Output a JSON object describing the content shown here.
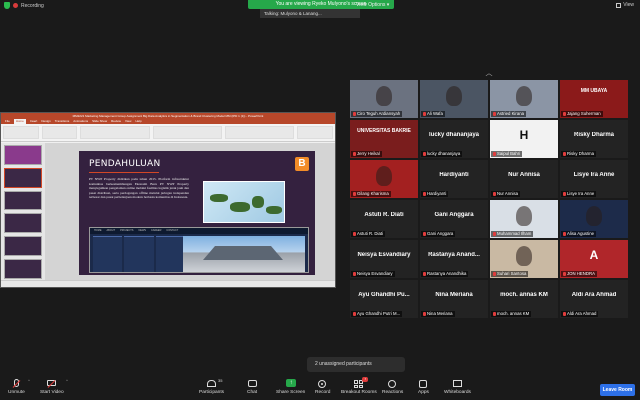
{
  "topbar": {
    "recording_label": "Recording",
    "share_banner": "You are viewing Ryeko Mulyono's screen",
    "view_options": "View Options",
    "view_button": "View",
    "talking_label": "Talking: Mulyono & Lanang..."
  },
  "shared_screen": {
    "ppt_title": "MM2221 Marketing Management Group Assignment Big Data Analytics in Segmentation & Brand Clustering Model MM (IPD 1 (1)) - PowerPoint",
    "ppt_tabs": [
      "File",
      "Home",
      "Insert",
      "Design",
      "Transitions",
      "Animations",
      "Slide Show",
      "Review",
      "View",
      "Help"
    ],
    "active_tab": "Home",
    "slide": {
      "title": "PENDAHULUAN",
      "body": "PT NWP Property didirikan pada tahun 2015. Platform infrastruktur komunitas berkesinambungan Ekonomi Baru PT NWP Property menyuguhkan pengalaman online melalui fasilitas logistik jarak jauh dan pusat distribusi, serta perdagangan offline melalui jaringan independen terbesar dan pusat perbelanjaan modern berbasis komunitas di Indonesia.",
      "logo_letter": "B",
      "banner_nav": [
        "HOME",
        "ABOUT",
        "PROJECTS",
        "NEWS",
        "CAREER",
        "CONTACT"
      ]
    }
  },
  "participants": [
    {
      "display": "",
      "label": "Ciro Teguh Ardiansyah",
      "photo": true,
      "bg": "#6b7280"
    },
    {
      "display": "",
      "label": "Ali Wafa",
      "photo": true,
      "bg": "#4b5563"
    },
    {
      "display": "",
      "label": "Astried Kirana",
      "photo": true,
      "bg": "#8b95a5"
    },
    {
      "display": "",
      "label": "Jajang Suherman",
      "photo": true,
      "bg": "#8b1a1a",
      "text": "MM UBAYA"
    },
    {
      "display": "",
      "label": "Jerry Heikal",
      "photo": true,
      "bg": "#7a1d1d",
      "text": "UNIVERSITAS BAKRIE"
    },
    {
      "display": "lucky dhananjaya",
      "label": "lucky dhananjaya"
    },
    {
      "display": "",
      "label": "Saipul Bahri",
      "photo": true,
      "bg": "#f2f2f2",
      "text": "H"
    },
    {
      "display": "Risky Dharma",
      "label": "Risky Dharma"
    },
    {
      "display": "",
      "label": "Gilang Kharisma",
      "photo": true,
      "bg": "#a32020"
    },
    {
      "display": "Hardiyanti",
      "label": "Hardiyanti"
    },
    {
      "display": "Nur Annisa",
      "label": "Nur Annisa"
    },
    {
      "display": "Lisye Ira Anne",
      "label": "Lisye Ira Anne"
    },
    {
      "display": "Astuti R. Diati",
      "label": "Astuti R. Diati"
    },
    {
      "display": "Gani Anggara",
      "label": "Gani Anggara"
    },
    {
      "display": "",
      "label": "Muhammad Ilham",
      "photo": true,
      "bg": "#d9dfe6"
    },
    {
      "display": "",
      "label": "Alisa Agustine",
      "photo": true,
      "bg": "#1d2b4a"
    },
    {
      "display": "Neisya Esvandiary",
      "label": "Neisya Esvandiary"
    },
    {
      "display": "Rastanya Anand...",
      "label": "Rastanya Anandhika"
    },
    {
      "display": "",
      "label": "Suhari Santosa",
      "photo": true,
      "bg": "#c9b9a3"
    },
    {
      "display": "",
      "label": "JON HENDRA",
      "photo": true,
      "bg": "#b0262a",
      "text": "A"
    },
    {
      "display": "Ayu Ghandhi Pu...",
      "label": "Ayu Ghandhi Putri M..."
    },
    {
      "display": "Nina Meriana",
      "label": "Nina Meriana"
    },
    {
      "display": "moch. annas KM",
      "label": "moch. annas KM"
    },
    {
      "display": "Aldi Ara Ahmad",
      "label": "Aldi Ara Ahmad"
    }
  ],
  "unassigned": "2 unassigned participants",
  "toolbar": {
    "unmute": "Unmute",
    "start_video": "Start Video",
    "participants": "Participants",
    "participants_count": "35",
    "chat": "Chat",
    "share_screen": "Share Screen",
    "record": "Record",
    "breakout_rooms": "Breakout Rooms",
    "reactions": "Reactions",
    "apps": "Apps",
    "whiteboards": "Whiteboards",
    "leave_room": "Leave Room"
  },
  "colors": {
    "share_green": "#26a84a",
    "leave_blue": "#2d70e8",
    "ppt_orange": "#b7472a",
    "slide_purple": "#34213f"
  }
}
